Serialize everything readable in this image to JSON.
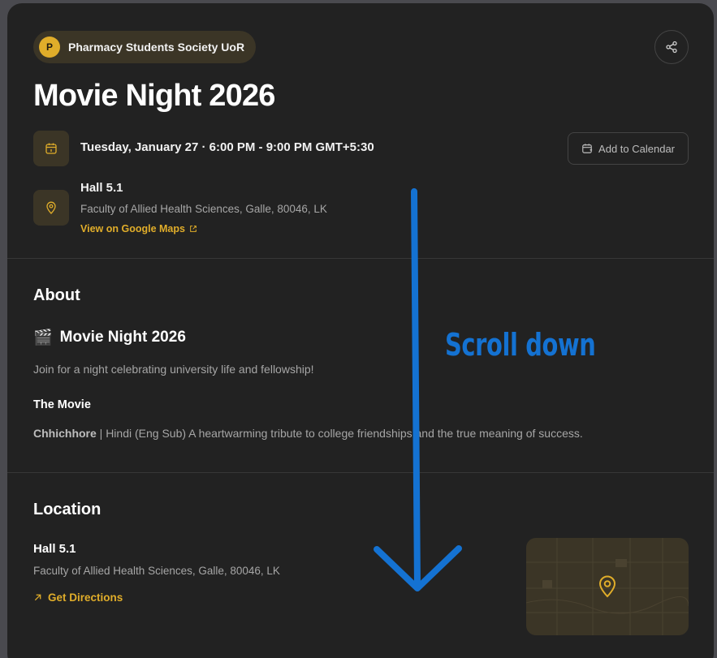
{
  "organizer": {
    "initial": "P",
    "name": "Pharmacy Students Society UoR"
  },
  "event": {
    "title": "Movie Night 2026",
    "date_time": "Tuesday, January 27 · 6:00 PM - 9:00 PM GMT+5:30",
    "add_to_calendar_label": "Add to Calendar"
  },
  "venue": {
    "name": "Hall 5.1",
    "address": "Faculty of Allied Health Sciences, Galle, 80046, LK",
    "maps_link_label": "View on Google Maps"
  },
  "about": {
    "section_title": "About",
    "heading_emoji": "🎬",
    "heading": "Movie Night 2026",
    "description": "Join for a night celebrating university life and fellowship!",
    "movie_heading": "The Movie",
    "movie_name": "Chhichhore",
    "movie_details": " | Hindi (Eng Sub) A heartwarming tribute to college friendships and the true meaning of success."
  },
  "location": {
    "section_title": "Location",
    "name": "Hall 5.1",
    "address": "Faculty of Allied Health Sciences, Galle, 80046, LK",
    "directions_label": "Get Directions"
  },
  "annotation": {
    "text": "Scroll down"
  },
  "colors": {
    "background": "#222222",
    "accent": "#e0ad2a",
    "icon_tile": "#3b3526",
    "annotation": "#1472d2"
  },
  "icons": {
    "share": "share-icon",
    "calendar": "calendar-icon",
    "pin": "map-pin-icon",
    "external": "external-link-icon",
    "directions": "arrow-up-right-icon"
  }
}
